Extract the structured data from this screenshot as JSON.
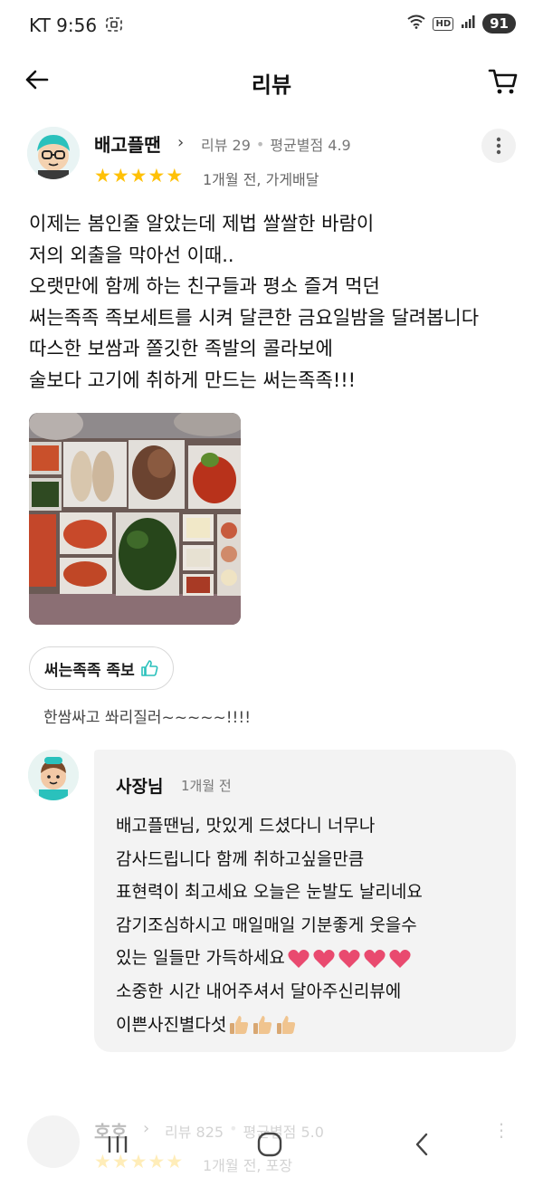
{
  "status_bar": {
    "carrier_time": "KT 9:56",
    "hd": "HD",
    "battery": "91"
  },
  "header": {
    "title": "리뷰"
  },
  "review": {
    "author": "배고플땐",
    "review_count": "리뷰 29",
    "avg_rating": "평균별점 4.9",
    "rating": 5,
    "date_type": "1개월 전, 가게배달",
    "body_lines": [
      "이제는 봄인줄 알았는데 제법 쌀쌀한 바람이",
      "저의 외출을 막아선 이때..",
      "오랫만에 함께 하는 친구들과 평소 즐겨 먹던",
      "써는족족 족보세트를 시켜 달큰한 금요일밤을 달려봅니다",
      "따스한 보쌈과 쫄깃한 족발의 콜라보에",
      "술보다 고기에 취하게 만드는 써는족족!!!"
    ],
    "menu_tag": "써는족족 족보",
    "menu_comment": "한쌈싸고 쏴리질러~~~~~!!!!"
  },
  "owner_reply": {
    "name": "사장님",
    "date": "1개월 전",
    "lines": [
      "배고플땐님, 맛있게 드셨다니 너무나",
      "감사드립니다 함께 취하고싶을만큼",
      "표현력이 최고세요 오늘은 눈발도 날리네요",
      "감기조심하시고 매일매일 기분좋게 웃을수",
      "있는 일들만 가득하세요",
      "소중한 시간 내어주셔서 달아주신리뷰에",
      "이쁜사진별다섯"
    ]
  },
  "next_review": {
    "author": "호호",
    "review_count": "리뷰 825",
    "avg_rating": "평균별점 5.0",
    "rating": 5,
    "date_type": "1개월 전, 포장"
  },
  "colors": {
    "star": "#ffc107",
    "heart": "#e94a6f",
    "like": "#2ac1bc"
  }
}
